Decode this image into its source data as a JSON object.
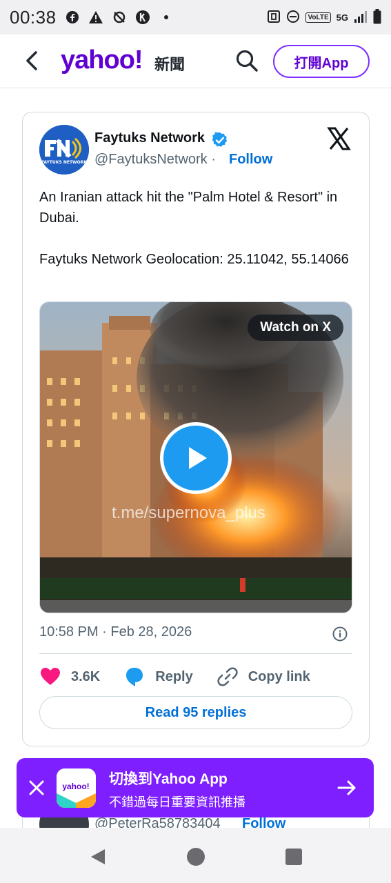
{
  "status_bar": {
    "time": "00:38",
    "volte": "VoLTE",
    "network": "5G"
  },
  "app_bar": {
    "logo_text": "yahoo!",
    "logo_sub": "新聞",
    "open_app_label": "打開App"
  },
  "tweet": {
    "author_name": "Faytuks Network",
    "handle": "@FaytuksNetwork",
    "separator": "·",
    "follow_label": "Follow",
    "avatar_text": "FN",
    "avatar_caption": "FAYTUKS NETWORK",
    "text": "An Iranian attack hit the \"Palm Hotel & Resort\" in Dubai.\n\nFaytuks Network Geolocation: 25.11042, 55.14066",
    "media": {
      "watch_label": "Watch on X",
      "watermark": "t.me/supernova_plus"
    },
    "timestamp": "10:58 PM · Feb 28, 2026",
    "likes": "3.6K",
    "reply_label": "Reply",
    "copy_link_label": "Copy link",
    "read_replies_label": "Read 95 replies"
  },
  "next_tweet": {
    "handle": "@PeterRa58783404",
    "follow_label": "Follow"
  },
  "banner": {
    "logo_text": "yahoo!",
    "title": "切換到Yahoo App",
    "subtitle": "不錯過每日重要資訊推播"
  },
  "colors": {
    "yahoo_purple": "#6001d2",
    "banner_purple": "#7e1fff",
    "x_blue": "#1d9bf0",
    "link_blue": "#006fd6",
    "heart_pink": "#f91880"
  }
}
